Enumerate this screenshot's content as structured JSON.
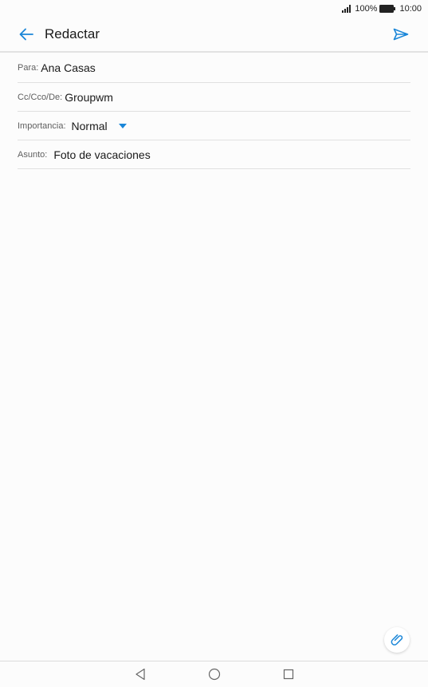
{
  "status_bar": {
    "battery_percent": "100%",
    "time": "10:00",
    "icons": [
      "signal-icon",
      "battery-icon"
    ]
  },
  "app_bar": {
    "title": "Redactar",
    "icons": [
      "back-arrow-icon",
      "send-icon"
    ]
  },
  "fields": {
    "to": {
      "label": "Para:",
      "value": "Ana Casas"
    },
    "cc": {
      "label": "Cc/Cco/De:",
      "value": "Groupwm"
    },
    "importance": {
      "label": "Importancia:",
      "value": "Normal"
    },
    "subject": {
      "label": "Asunto:",
      "value": "Foto de vacaciones"
    }
  },
  "attach_icon": "paperclip-icon",
  "nav_bar": {
    "icons": [
      "nav-back-icon",
      "nav-home-icon",
      "nav-recent-icon"
    ]
  },
  "colors": {
    "accent": "#1a86d8",
    "background": "#fcfcfc",
    "divider": "#e0e0e0"
  }
}
